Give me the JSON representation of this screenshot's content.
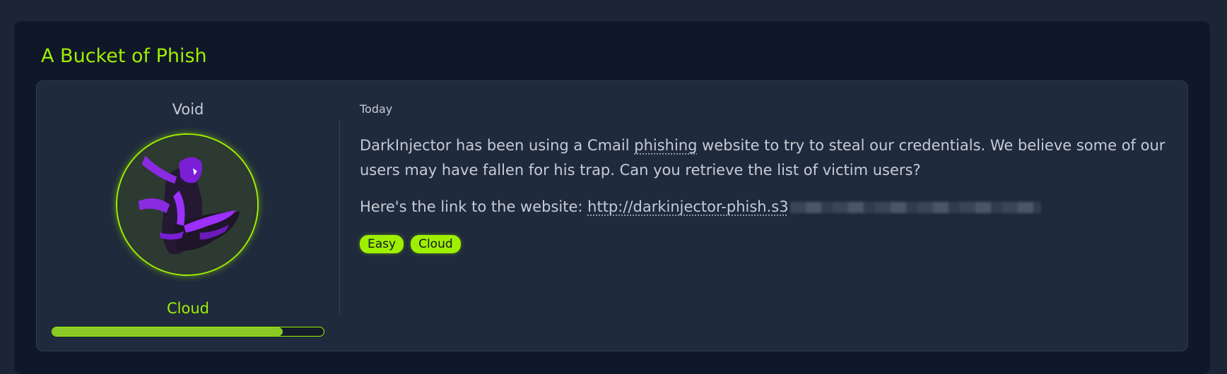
{
  "challenge": {
    "title": "A Bucket of Phish"
  },
  "author": {
    "name": "Void",
    "avatar_icon": "purple-figure-avatar"
  },
  "category": {
    "name": "Cloud",
    "progress": 0.85
  },
  "post": {
    "date": "Today",
    "desc_before": "DarkInjector has been using a Cmail ",
    "desc_link_word": "phishing",
    "desc_after": " website to try to steal our credentials. We believe some of our users may have fallen for his trap. Can you retrieve the list of victim users?",
    "link_label": "Here's the link to the website: ",
    "link_visible": "http://darkinjector-phish.s3"
  },
  "tags": [
    "Easy",
    "Cloud"
  ],
  "colors": {
    "accent": "#9fef00",
    "card_bg": "#1f2a3c",
    "page_bg": "#1c2536"
  }
}
